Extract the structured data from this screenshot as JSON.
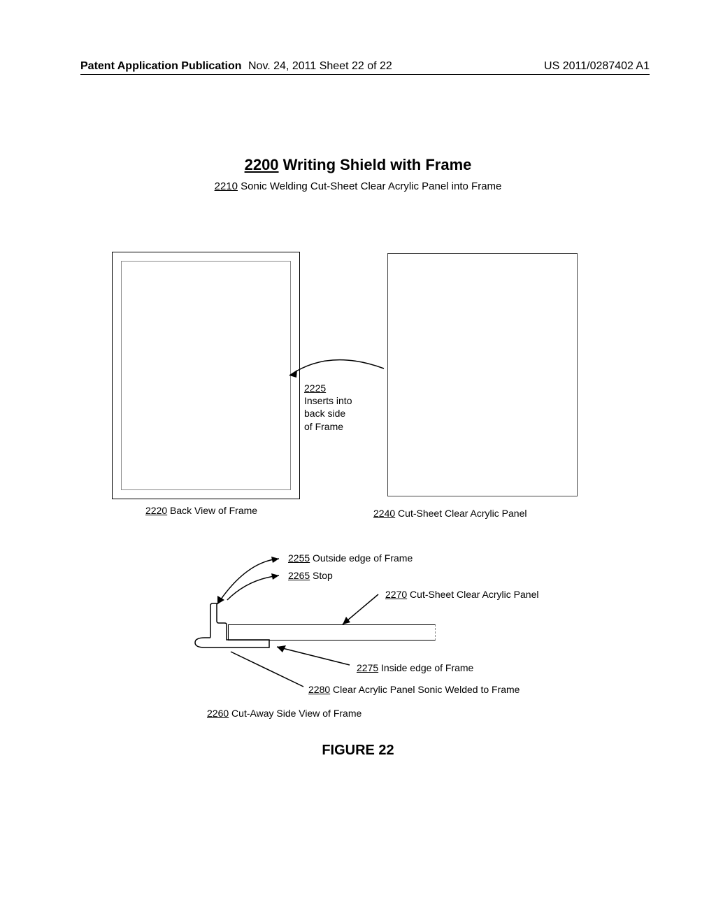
{
  "header": {
    "left": "Patent Application Publication",
    "middle": "Nov. 24, 2011   Sheet 22 of 22",
    "right": "US 2011/0287402 A1"
  },
  "title": {
    "number": "2200",
    "text": " Writing Shield with Frame"
  },
  "subtitle": {
    "number": "2210",
    "text": " Sonic Welding Cut-Sheet Clear Acrylic Panel into Frame"
  },
  "labels": {
    "l2225_num": "2225",
    "l2225_1": "Inserts into",
    "l2225_2": "back side",
    "l2225_3": "of Frame",
    "l2220_num": "2220",
    "l2220_text": " Back View of Frame",
    "l2240_num": "2240",
    "l2240_text": " Cut-Sheet Clear Acrylic Panel",
    "l2255_num": "2255",
    "l2255_text": " Outside edge of Frame",
    "l2265_num": "2265",
    "l2265_text": " Stop",
    "l2270_num": "2270",
    "l2270_text": " Cut-Sheet Clear Acrylic Panel",
    "l2275_num": "2275",
    "l2275_text": " Inside edge of Frame",
    "l2280_num": "2280",
    "l2280_text": " Clear Acrylic Panel Sonic Welded to Frame",
    "l2260_num": "2260",
    "l2260_text": " Cut-Away Side View of Frame"
  },
  "figure": "FIGURE 22"
}
